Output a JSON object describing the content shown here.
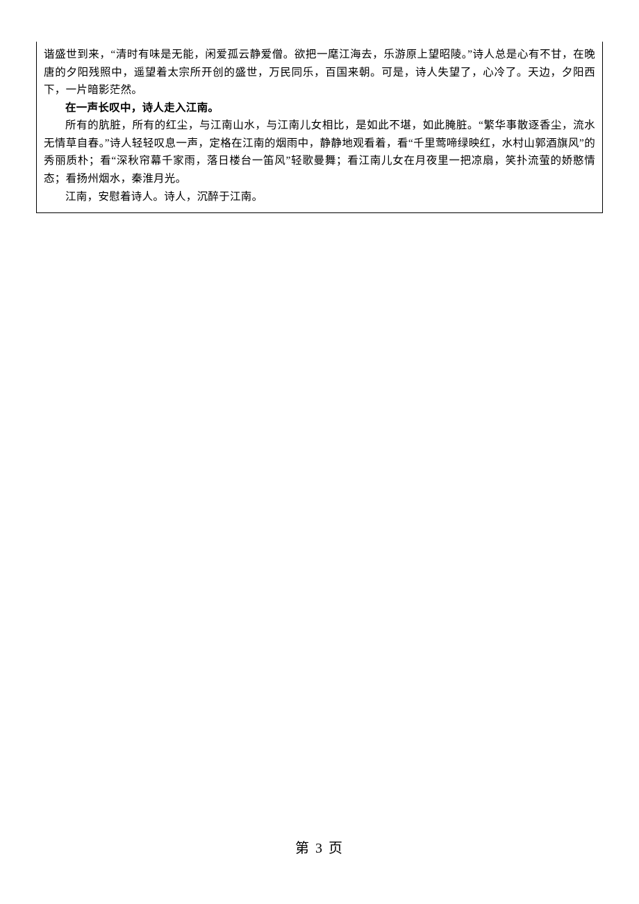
{
  "content": {
    "p1": "谐盛世到来，“清时有味是无能，闲爱孤云静爱僧。欲把一麾江海去，乐游原上望昭陵。”诗人总是心有不甘，在晚唐的夕阳残照中，遥望着太宗所开创的盛世，万民同乐，百国来朝。可是，诗人失望了，心冷了。天边，夕阳西下，一片暗影茫然。",
    "p2_bold": "在一声长叹中，诗人走入江南。",
    "p3": "所有的肮脏，所有的红尘，与江南山水，与江南儿女相比，是如此不堪，如此腌脏。“繁华事散逐香尘，流水无情草自春。”诗人轻轻叹息一声，定格在江南的烟雨中，静静地观看着，看“千里莺啼绿映红，水村山郭酒旗风”的秀丽质朴；看“深秋帘幕千家雨，落日楼台一笛风”轻歌曼舞；看江南儿女在月夜里一把凉扇，笑扑流萤的娇憨情态；看扬州烟水，秦淮月光。",
    "p4": "江南，安慰着诗人。诗人，沉醉于江南。"
  },
  "footer": {
    "page_label": "第 3 页"
  }
}
